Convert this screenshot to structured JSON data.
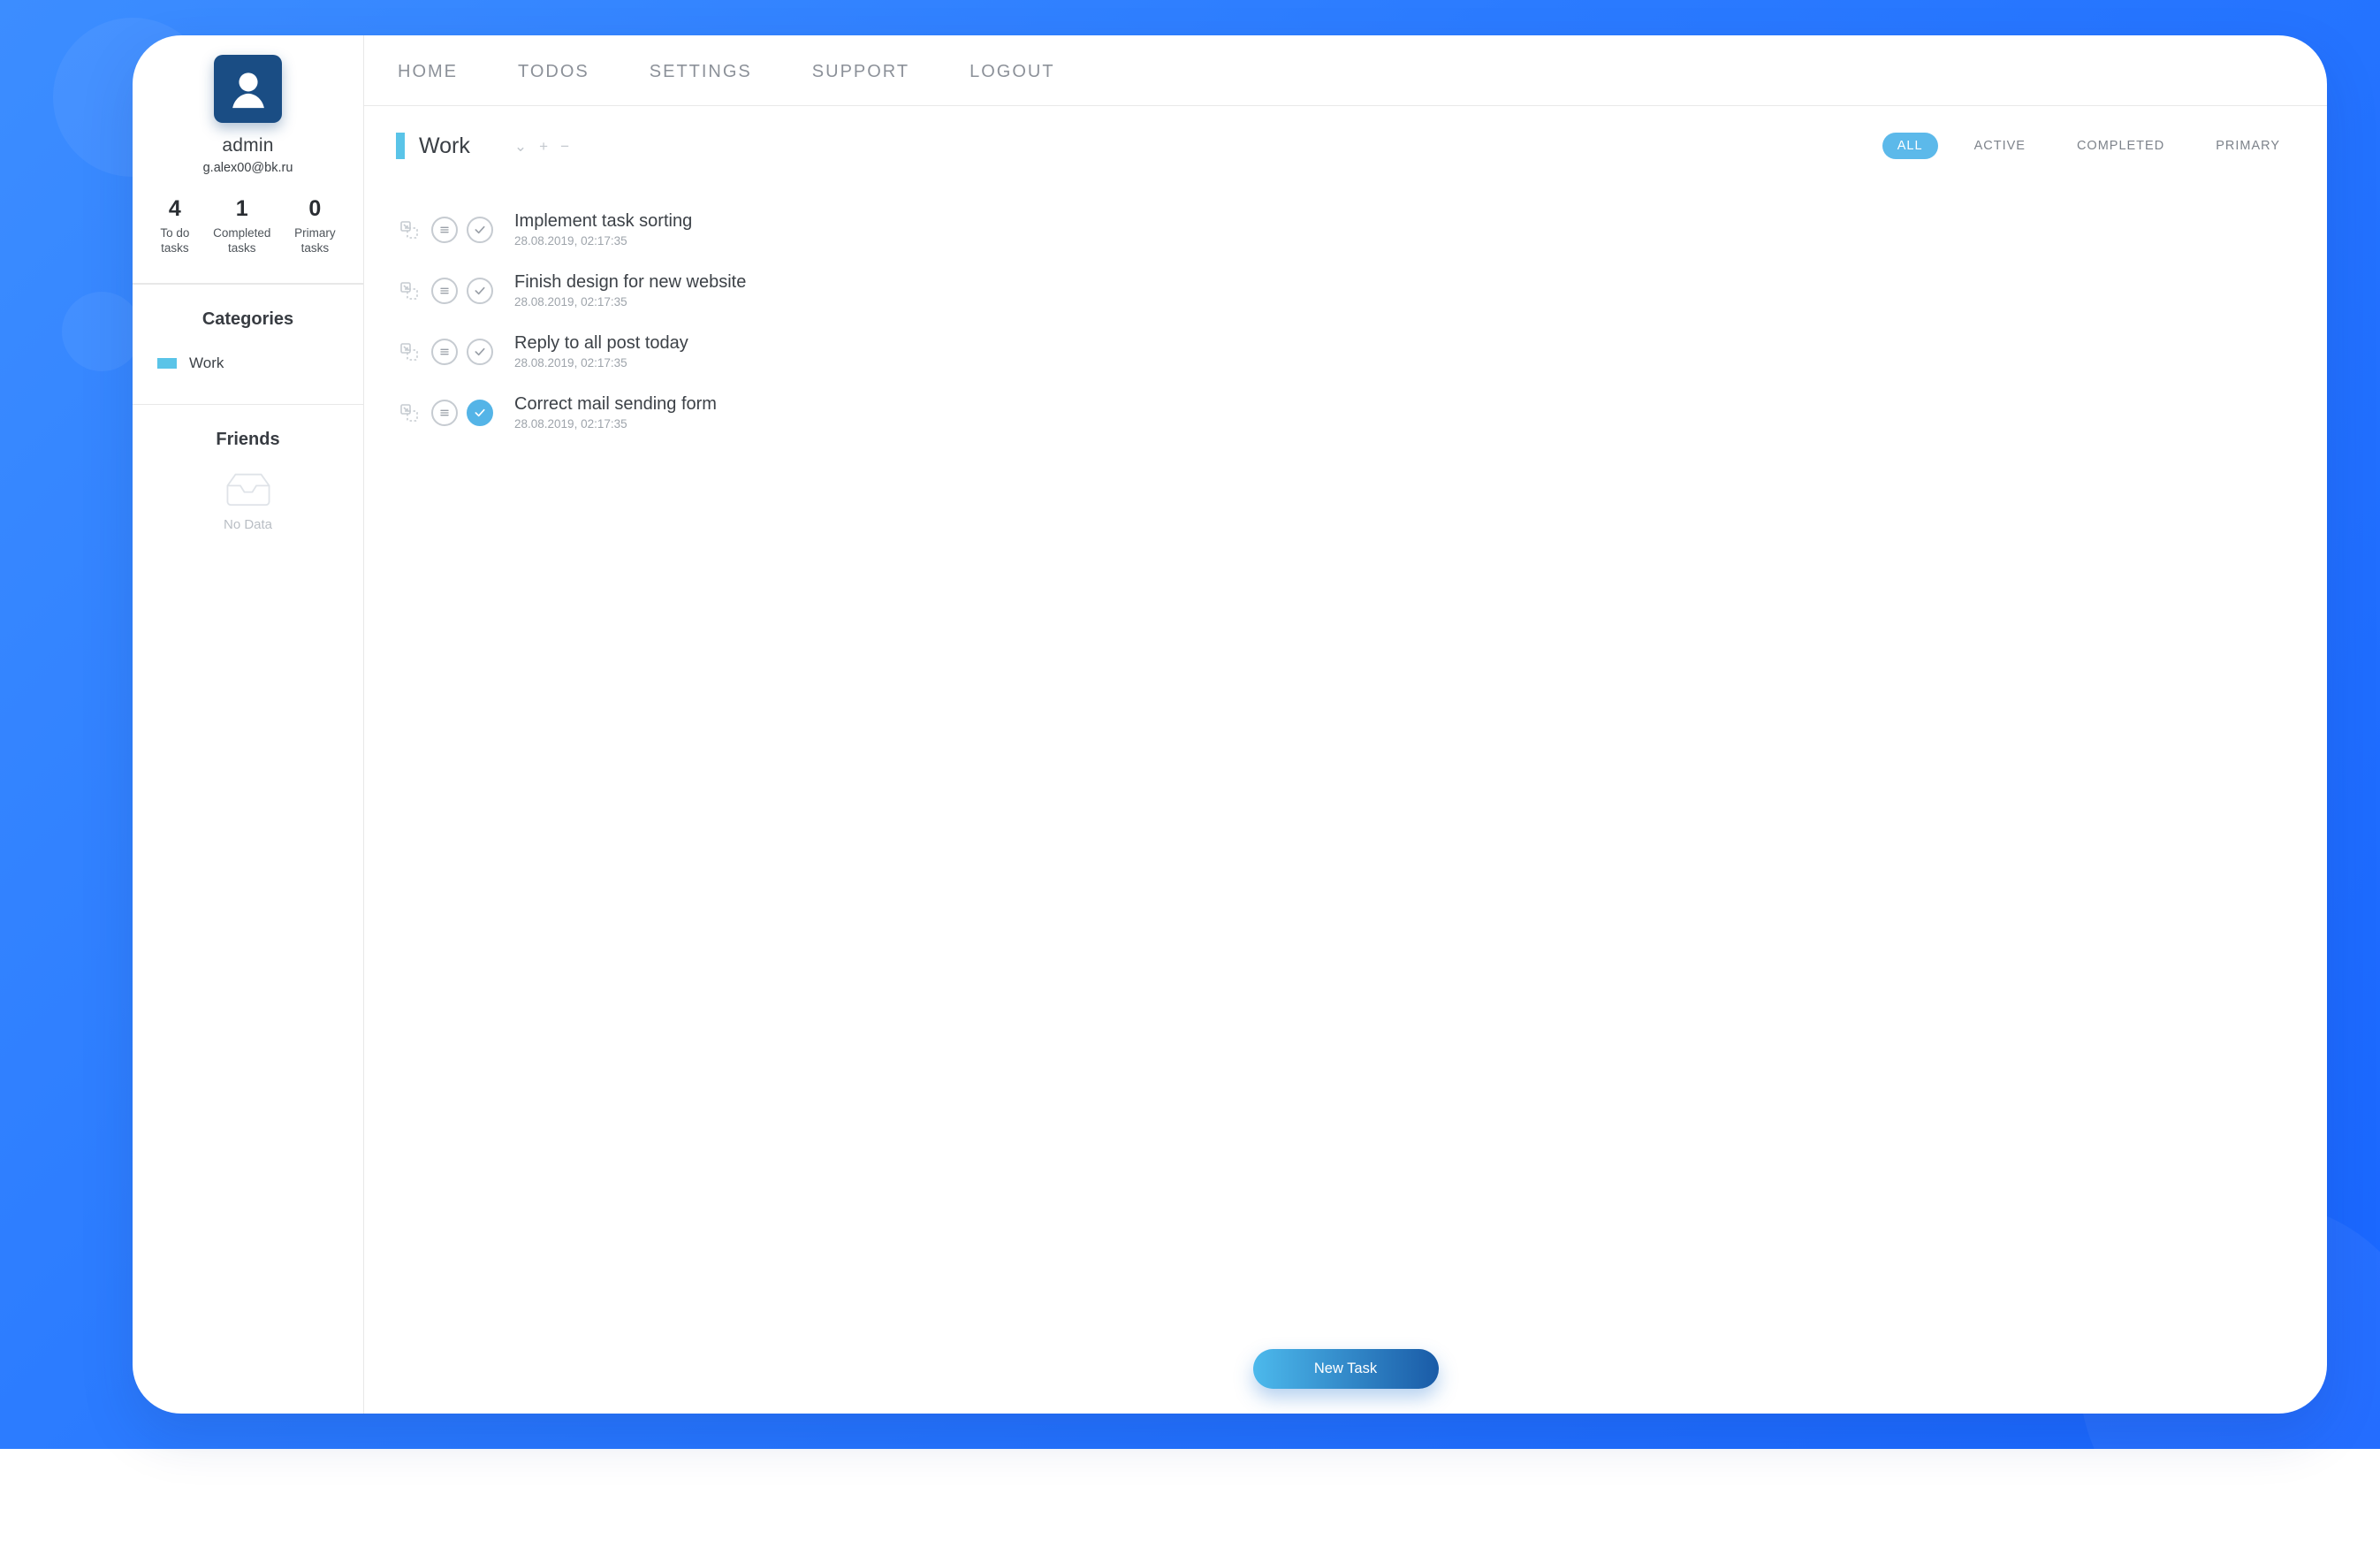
{
  "user": {
    "name": "admin",
    "email": "g.alex00@bk.ru"
  },
  "stats": {
    "todo": {
      "count": "4",
      "label": "To do\ntasks"
    },
    "completed": {
      "count": "1",
      "label": "Completed\ntasks"
    },
    "primary": {
      "count": "0",
      "label": "Primary\ntasks"
    }
  },
  "sidebar": {
    "categories_title": "Categories",
    "categories": [
      {
        "name": "Work",
        "color": "#5ac4e8"
      }
    ],
    "friends_title": "Friends",
    "friends_empty": "No Data"
  },
  "nav": {
    "home": "HOME",
    "todos": "TODOS",
    "settings": "SETTINGS",
    "support": "SUPPORT",
    "logout": "LOGOUT"
  },
  "current_category": "Work",
  "filters": {
    "all": "ALL",
    "active": "ACTIVE",
    "completed": "COMPLETED",
    "primary": "PRIMARY"
  },
  "tasks": [
    {
      "title": "Implement task sorting",
      "date": "28.08.2019, 02:17:35",
      "done": false
    },
    {
      "title": "Finish design for new website",
      "date": "28.08.2019, 02:17:35",
      "done": false
    },
    {
      "title": "Reply to all post today",
      "date": "28.08.2019, 02:17:35",
      "done": false
    },
    {
      "title": "Correct mail sending form",
      "date": "28.08.2019, 02:17:35",
      "done": true
    }
  ],
  "buttons": {
    "new_task": "New Task"
  }
}
